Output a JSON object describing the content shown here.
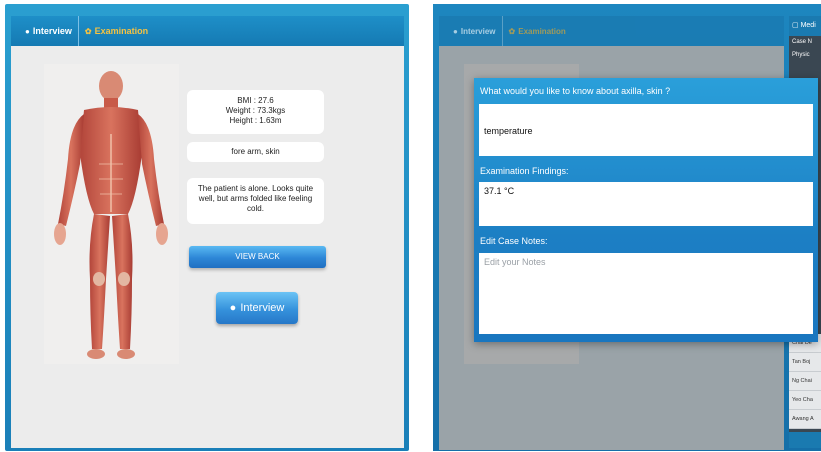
{
  "left": {
    "tabs": {
      "interview": "Interview",
      "examination": "Examination"
    },
    "patient": {
      "bmi": "BMI :  27.6",
      "weight": "Weight :  73.3kgs",
      "height": "Height :  1.63m"
    },
    "region": "fore arm, skin",
    "observation": "The patient is alone. Looks quite well, but arms folded like feeling cold.",
    "view_back_button": "VIEW BACK",
    "interview_button": "Interview"
  },
  "right": {
    "tabs": {
      "interview": "Interview",
      "examination": "Examination"
    },
    "side_panel": {
      "header": "Medi",
      "lines": [
        "Case N",
        "Physic"
      ],
      "list": [
        "Chai De",
        "Tan Boj",
        "Ng Chai",
        "Yeo Cha",
        "Awang A"
      ]
    },
    "modal": {
      "question": "What would you like to know about axilla, skin ?",
      "question_value": "temperature",
      "findings_label": "Examination Findings:",
      "findings_value": "37.1 °C",
      "notes_label": "Edit Case Notes:",
      "notes_placeholder": "Edit your Notes"
    }
  },
  "colors": {
    "frame_blue": "#1a7fb8",
    "exam_tab_gold": "#f5c242",
    "button_blue": "#2d86d6"
  }
}
